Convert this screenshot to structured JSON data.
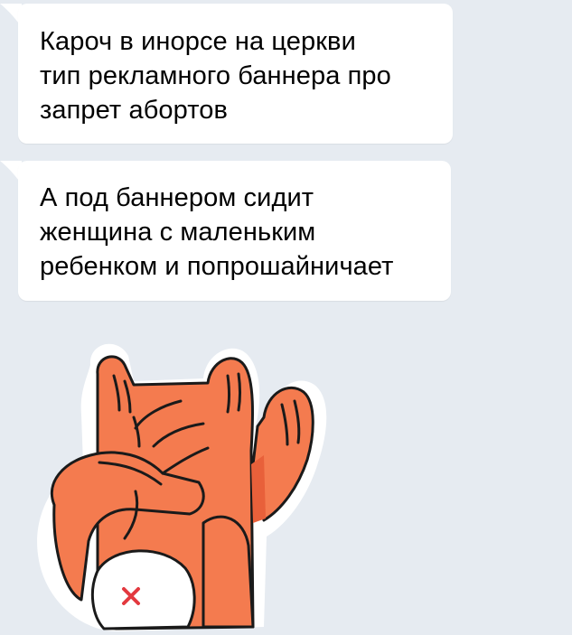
{
  "messages": [
    {
      "lines": [
        "Кароч в инорсе на церкви",
        "тип рекламного баннера про",
        "запрет абортов"
      ]
    },
    {
      "lines": [
        "А под баннером сидит",
        "женщина с маленьким",
        "ребенком и попрошайничает"
      ]
    }
  ],
  "sticker": {
    "icon": "cat-facepalm-sticker",
    "colors": {
      "fur": "#f47b4f",
      "fur_shadow": "#e8603a",
      "outline": "#1a1a1a",
      "belly": "#ffffff",
      "mark": "#e3393f"
    }
  },
  "colors": {
    "background": "#e6ebf1",
    "bubble": "#ffffff",
    "text": "#000000"
  }
}
